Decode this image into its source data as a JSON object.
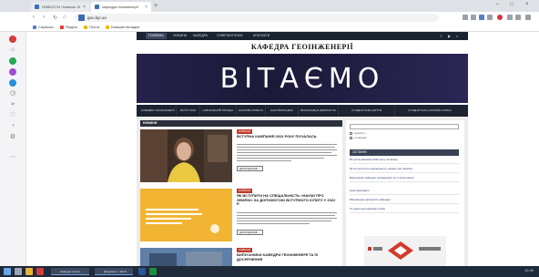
{
  "browser": {
    "tabs": [
      {
        "title": "НОВОСТИ / Каталог 2019 ..."
      },
      {
        "title": "кафедра геоінженерії"
      }
    ],
    "url": "geo.kpi.ua",
    "bookmarks": [
      "Сервисы",
      "Яндекс",
      "Почта",
      "Бывшие вкладки"
    ]
  },
  "site": {
    "topnav": [
      "ГОЛОВНА",
      "НОВИНИ",
      "КАФЕДРА",
      "СПІВРОБІТНИКИ",
      "КОНТАКТИ"
    ],
    "title": "КАФЕДРА ГЕОІНЖЕНЕРІЇ",
    "banner_text": "ВІТАЄМО",
    "menu": [
      "КАФЕДРА ГЕОІНЖЕНЕРІЇ",
      "ВСТУП 2022",
      "НАВЧАЛЬНИЙ ПРОЦЕС",
      "НАУКОВА РОБОТА",
      "НАШІ ВИКЛАДАЧІ",
      "МІЖНАРОДНА ДІЯЛЬНІСТЬ",
      "СТУДЕНТСЬКЕ ЖИТТЯ",
      "СТУДЕНТСЬКА НАУКОВА СПІЛКА"
    ],
    "news_header": "НОВИНИ",
    "posts": [
      {
        "tag": "НОВИНИ",
        "title": "ВСТУПНА КАМПАНІЯ 2022 РОКУ ПОЧАЛАСЬ",
        "more": "ДОКЛАДНІШЕ ..."
      },
      {
        "tag": "НОВИНИ",
        "title": "ЯК ВСТУПИТИ НА СПЕЦІАЛЬНІСТЬ «НАУКИ ПРО ЗЕМЛЮ» ЗА ДОПОМОГОЮ ВСТУПНОГО ІСПИТУ У 2022 Р.",
        "more": "ДОКЛАДНІШЕ ..."
      },
      {
        "tag": "НОВИНИ",
        "title": "ВИПУСКНИКИ КАФЕДРИ ГЕОІНЖЕНЕРІЇ ТА ЇХ ДОСЯГНЕННЯ"
      }
    ],
    "search": {
      "options": [
        "шукати у ...",
        "у новинах"
      ]
    },
    "recent_header": "ОСТАННІ",
    "recent": [
      "Вступна кампанія 2022 року почалась",
      "Як вступити на спеціальність «Науки про Землю»",
      "Випускники кафедри геоінженерії та їх досягнення",
      "Наші викладачі",
      "Міжнародна діяльність кафедри",
      "Студентська наукова спілка"
    ]
  },
  "taskbar": {
    "windows": [
      "кафедра геоінж...",
      "Документ1 - Word"
    ],
    "tray": "12:45"
  }
}
